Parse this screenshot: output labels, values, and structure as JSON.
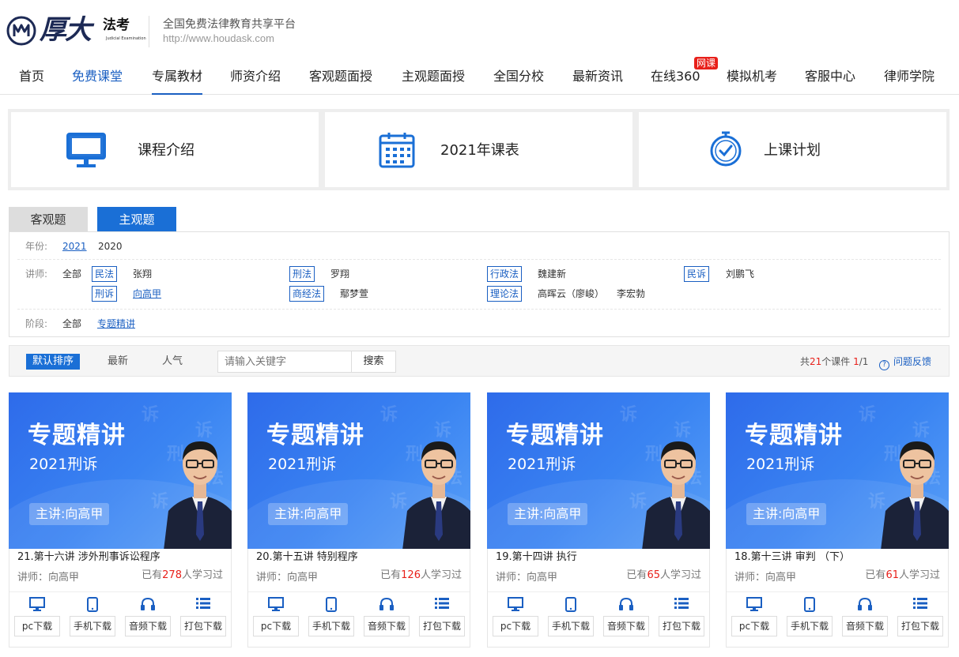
{
  "brand": {
    "logo_text": "厚大",
    "logo_sub": "法考",
    "logo_en": "Judicial Examination",
    "slogan": "全国免费法律教育共享平台",
    "url": "http://www.houdask.com"
  },
  "nav": {
    "items": [
      "首页",
      "免费课堂",
      "专属教材",
      "师资介绍",
      "客观题面授",
      "主观题面授",
      "全国分校",
      "最新资讯",
      "在线360",
      "模拟机考",
      "客服中心",
      "律师学院"
    ],
    "badge": "网课"
  },
  "quick_links": [
    "课程介绍",
    "2021年课表",
    "上课计划"
  ],
  "tabs": [
    "客观题",
    "主观题"
  ],
  "filter": {
    "year_label": "年份:",
    "years": [
      "2021",
      "2020"
    ],
    "teacher_label": "讲师:",
    "all": "全部",
    "subjects": [
      {
        "tag": "民法",
        "teachers": [
          "张翔"
        ]
      },
      {
        "tag": "刑法",
        "teachers": [
          "罗翔"
        ]
      },
      {
        "tag": "行政法",
        "teachers": [
          "魏建新"
        ]
      },
      {
        "tag": "民诉",
        "teachers": [
          "刘鹏飞"
        ]
      },
      {
        "tag": "刑诉",
        "teachers": [
          "向高甲"
        ]
      },
      {
        "tag": "商经法",
        "teachers": [
          "鄢梦萱"
        ]
      },
      {
        "tag": "理论法",
        "teachers": [
          "高晖云（廖峻）",
          "李宏勃"
        ]
      }
    ],
    "stage_label": "阶段:",
    "stages": [
      "全部",
      "专题精讲"
    ]
  },
  "toolbar": {
    "sort_default": "默认排序",
    "sort_new": "最新",
    "sort_popular": "人气",
    "search_placeholder": "请输入关键字",
    "search_button": "搜索",
    "count_prefix": "共",
    "count_total": "21",
    "count_mid": "个课件 ",
    "count_page": "1",
    "count_suffix": "/1",
    "feedback": "问题反馈"
  },
  "thumb": {
    "title": "专题精讲",
    "subtitle": "2021刑诉",
    "lecturer": "主讲:向高甲"
  },
  "courses": [
    {
      "title": "21.第十六讲 涉外刑事诉讼程序",
      "teacher": "讲师：向高甲",
      "count": "278"
    },
    {
      "title": "20.第十五讲 特别程序",
      "teacher": "讲师：向高甲",
      "count": "126"
    },
    {
      "title": "19.第十四讲 执行",
      "teacher": "讲师：向高甲",
      "count": "65"
    },
    {
      "title": "18.第十三讲 审判 （下）",
      "teacher": "讲师：向高甲",
      "count": "61"
    }
  ],
  "learned_prefix": "已有",
  "learned_suffix": "人学习过",
  "downloads": [
    "pc下载",
    "手机下载",
    "音频下载",
    "打包下载"
  ],
  "colors": {
    "accent": "#1a6fd6",
    "link": "#1a5fc2",
    "red": "#e8201a"
  }
}
